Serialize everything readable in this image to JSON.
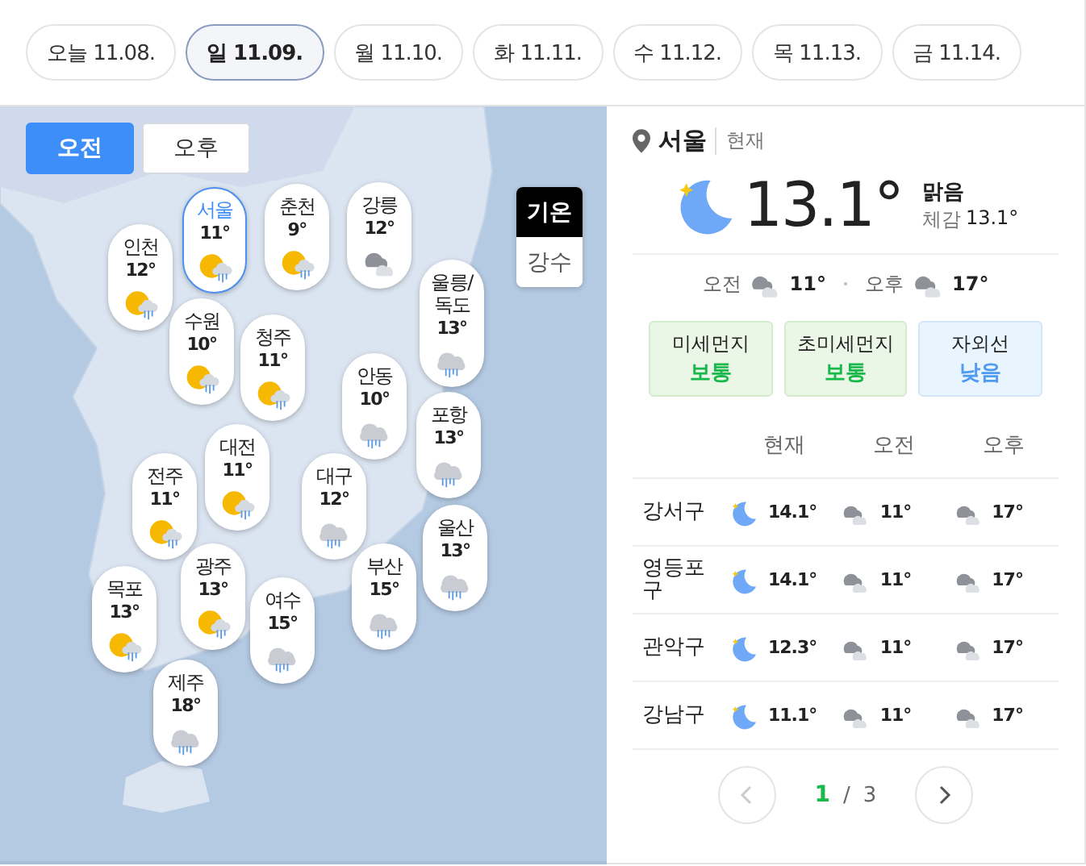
{
  "date_tabs": [
    {
      "label": "오늘 11.08.",
      "selected": false
    },
    {
      "label": "일 11.09.",
      "selected": true
    },
    {
      "label": "월 11.10.",
      "selected": false
    },
    {
      "label": "화 11.11.",
      "selected": false
    },
    {
      "label": "수 11.12.",
      "selected": false
    },
    {
      "label": "목 11.13.",
      "selected": false
    },
    {
      "label": "금 11.14.",
      "selected": false
    }
  ],
  "map": {
    "period_toggle": [
      {
        "label": "오전",
        "selected": true
      },
      {
        "label": "오후",
        "selected": false
      }
    ],
    "layer_toggle": [
      {
        "label": "기온",
        "selected": true
      },
      {
        "label": "강수",
        "selected": false
      }
    ],
    "cities": [
      {
        "name": "서울",
        "temp": "11°",
        "kind": "sunrain",
        "selected": true
      },
      {
        "name": "춘천",
        "temp": "9°",
        "kind": "sunrain",
        "selected": false
      },
      {
        "name": "강릉",
        "temp": "12°",
        "kind": "cloudy",
        "selected": false
      },
      {
        "name": "인천",
        "temp": "12°",
        "kind": "sunrain",
        "selected": false
      },
      {
        "name": "울릉/독도",
        "temp": "13°",
        "kind": "rain",
        "selected": false
      },
      {
        "name": "수원",
        "temp": "10°",
        "kind": "sunrain",
        "selected": false
      },
      {
        "name": "청주",
        "temp": "11°",
        "kind": "sunrain",
        "selected": false
      },
      {
        "name": "안동",
        "temp": "10°",
        "kind": "rain",
        "selected": false
      },
      {
        "name": "포항",
        "temp": "13°",
        "kind": "rain",
        "selected": false
      },
      {
        "name": "대전",
        "temp": "11°",
        "kind": "sunrain",
        "selected": false
      },
      {
        "name": "전주",
        "temp": "11°",
        "kind": "sunrain",
        "selected": false
      },
      {
        "name": "대구",
        "temp": "12°",
        "kind": "rain",
        "selected": false
      },
      {
        "name": "울산",
        "temp": "13°",
        "kind": "rain",
        "selected": false
      },
      {
        "name": "부산",
        "temp": "15°",
        "kind": "rain",
        "selected": false
      },
      {
        "name": "광주",
        "temp": "13°",
        "kind": "sunrain",
        "selected": false
      },
      {
        "name": "목포",
        "temp": "13°",
        "kind": "sunrain",
        "selected": false
      },
      {
        "name": "여수",
        "temp": "15°",
        "kind": "rain",
        "selected": false
      },
      {
        "name": "제주",
        "temp": "18°",
        "kind": "rain",
        "selected": false
      }
    ]
  },
  "detail": {
    "location": "서울",
    "time_label": "현재",
    "kind": "moon",
    "temperature": "13.1°",
    "condition": "맑음",
    "feels_label": "체감",
    "feels_value": "13.1°",
    "am": {
      "label": "오전",
      "kind": "cloudy",
      "temp": "11°"
    },
    "pm": {
      "label": "오후",
      "kind": "cloudy",
      "temp": "17°"
    },
    "air": [
      {
        "label": "미세먼지",
        "value": "보통",
        "kind": "normal"
      },
      {
        "label": "초미세먼지",
        "value": "보통",
        "kind": "normal"
      },
      {
        "label": "자외선",
        "value": "낮음",
        "kind": "low"
      }
    ],
    "table": {
      "columns": [
        "현재",
        "오전",
        "오후"
      ],
      "rows": [
        {
          "district": "강서구",
          "now": {
            "kind": "moon",
            "temp": "14.1°"
          },
          "am": {
            "kind": "cloudy",
            "temp": "11°"
          },
          "pm": {
            "kind": "cloudy",
            "temp": "17°"
          }
        },
        {
          "district": "영등포구",
          "now": {
            "kind": "moon",
            "temp": "14.1°"
          },
          "am": {
            "kind": "cloudy",
            "temp": "11°"
          },
          "pm": {
            "kind": "cloudy",
            "temp": "17°"
          }
        },
        {
          "district": "관악구",
          "now": {
            "kind": "moon",
            "temp": "12.3°"
          },
          "am": {
            "kind": "cloudy",
            "temp": "11°"
          },
          "pm": {
            "kind": "cloudy",
            "temp": "17°"
          }
        },
        {
          "district": "강남구",
          "now": {
            "kind": "moon",
            "temp": "11.1°"
          },
          "am": {
            "kind": "cloudy",
            "temp": "11°"
          },
          "pm": {
            "kind": "cloudy",
            "temp": "17°"
          }
        }
      ]
    },
    "pagination": {
      "current": "1",
      "separator": "/",
      "total": "3",
      "prev_disabled": true,
      "next_disabled": false
    }
  }
}
